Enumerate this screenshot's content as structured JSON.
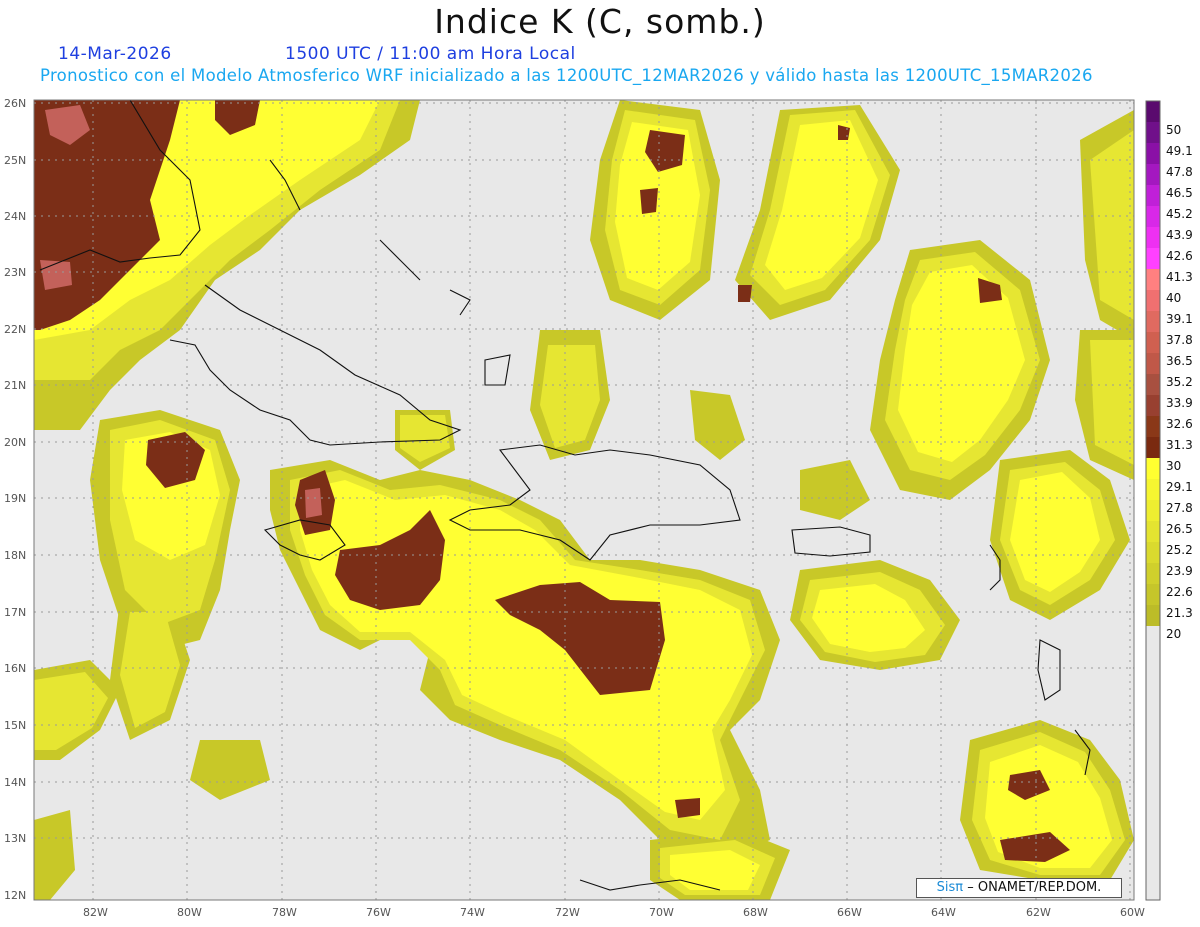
{
  "title": "Indice K (C, somb.)",
  "date": "14-Mar-2026",
  "time": "1500 UTC / 11:00 am Hora Local",
  "subtitle": "Pronostico con el Modelo Atmosferico WRF inicializado a las 1200UTC_12MAR2026 y válido hasta las  1200UTC_15MAR2026",
  "credit": {
    "logo": "Sisπ",
    "text": "– ONAMET/REP.DOM."
  },
  "lat_labels": [
    "26N",
    "25N",
    "24N",
    "23N",
    "22N",
    "21N",
    "20N",
    "19N",
    "18N",
    "17N",
    "16N",
    "15N",
    "14N",
    "13N",
    "12N"
  ],
  "lon_labels": [
    "82W",
    "80W",
    "78W",
    "76W",
    "74W",
    "72W",
    "70W",
    "68W",
    "66W",
    "64W",
    "62W",
    "60W"
  ],
  "colorbar": {
    "labels": [
      "50",
      "49.1",
      "47.8",
      "46.5",
      "45.2",
      "43.9",
      "42.6",
      "41.3",
      "40",
      "39.1",
      "37.8",
      "36.5",
      "35.2",
      "33.9",
      "32.6",
      "31.3",
      "30",
      "29.1",
      "27.8",
      "26.5",
      "25.2",
      "23.9",
      "22.6",
      "21.3",
      "20"
    ],
    "colors": [
      "#5a0a6e",
      "#70108a",
      "#8a10a6",
      "#a418c0",
      "#c020d8",
      "#d828e8",
      "#ee30f2",
      "#ff40ff",
      "#ff8080",
      "#f07070",
      "#e06a60",
      "#d06050",
      "#c05848",
      "#a85040",
      "#984030",
      "#8a3818",
      "#7a2a10",
      "#ffff30",
      "#f6f630",
      "#eeee30",
      "#e4e430",
      "#dada2e",
      "#d0d02c",
      "#c6c62a",
      "#bcbc28"
    ]
  },
  "colors": {
    "background_land": "#e8e8e8",
    "yellow_low": "#c8c828",
    "yellow_mid": "#e6e632",
    "yellow_high": "#ffff33",
    "brown": "#7b2e17",
    "pink": "#d06a66"
  }
}
